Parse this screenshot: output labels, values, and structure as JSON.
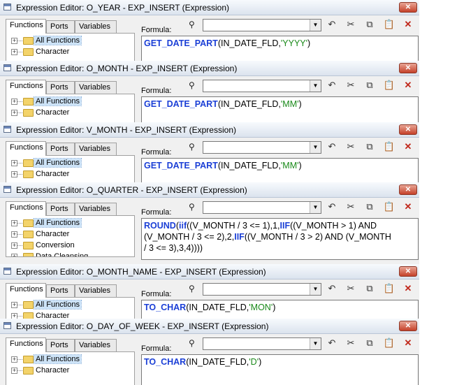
{
  "windows": [
    {
      "title": "Expression Editor: O_YEAR - EXP_INSERT (Expression)",
      "tabs": [
        "Functions",
        "Ports",
        "Variables"
      ],
      "tree_items": [
        "All Functions",
        "Character"
      ],
      "formula_label": "Formula:",
      "formula_lines": [
        [
          {
            "t": "GET_DATE_PART",
            "c": "kw"
          },
          {
            "t": "(IN_DATE_FLD,",
            "c": ""
          },
          {
            "t": "'YYYY'",
            "c": "str"
          },
          {
            "t": ")",
            "c": ""
          }
        ]
      ]
    },
    {
      "title": "Expression Editor: O_MONTH - EXP_INSERT (Expression)",
      "tabs": [
        "Functions",
        "Ports",
        "Variables"
      ],
      "tree_items": [
        "All Functions",
        "Character"
      ],
      "formula_label": "Formula:",
      "formula_lines": [
        [
          {
            "t": "GET_DATE_PART",
            "c": "kw"
          },
          {
            "t": "(IN_DATE_FLD,",
            "c": ""
          },
          {
            "t": "'MM'",
            "c": "str"
          },
          {
            "t": ")",
            "c": ""
          }
        ]
      ]
    },
    {
      "title": "Expression Editor: V_MONTH - EXP_INSERT (Expression)",
      "tabs": [
        "Functions",
        "Ports",
        "Variables"
      ],
      "tree_items": [
        "All Functions",
        "Character"
      ],
      "formula_label": "Formula:",
      "formula_lines": [
        [
          {
            "t": "GET_DATE_PART",
            "c": "kw"
          },
          {
            "t": "(IN_DATE_FLD,",
            "c": ""
          },
          {
            "t": "'MM'",
            "c": "str"
          },
          {
            "t": ")",
            "c": ""
          }
        ]
      ]
    },
    {
      "title": "Expression Editor: O_QUARTER - EXP_INSERT (Expression)",
      "tabs": [
        "Functions",
        "Ports",
        "Variables"
      ],
      "tree_items": [
        "All Functions",
        "Character",
        "Conversion",
        "Data Cleansing"
      ],
      "formula_label": "Formula:",
      "formula_lines": [
        [
          {
            "t": "ROUND",
            "c": "kw"
          },
          {
            "t": "(",
            "c": ""
          },
          {
            "t": "iif",
            "c": "kw"
          },
          {
            "t": "((V_MONTH / 3 <= 1),1,",
            "c": ""
          },
          {
            "t": "IIF",
            "c": "kw"
          },
          {
            "t": "((V_MONTH > 1) AND",
            "c": ""
          }
        ],
        [
          {
            "t": "(V_MONTH / 3 <= 2),2,",
            "c": ""
          },
          {
            "t": "IIF",
            "c": "kw"
          },
          {
            "t": "((V_MONTH / 3 > 2) AND (V_MONTH",
            "c": ""
          }
        ],
        [
          {
            "t": "/ 3 <= 3),3,4))))",
            "c": ""
          }
        ]
      ]
    },
    {
      "title": "Expression Editor: O_MONTH_NAME - EXP_INSERT (Expression)",
      "tabs": [
        "Functions",
        "Ports",
        "Variables"
      ],
      "tree_items": [
        "All Functions",
        "Character"
      ],
      "formula_label": "Formula:",
      "formula_lines": [
        [
          {
            "t": "TO_CHAR",
            "c": "kw"
          },
          {
            "t": "(IN_DATE_FLD,",
            "c": ""
          },
          {
            "t": "'MON'",
            "c": "str"
          },
          {
            "t": ")",
            "c": ""
          }
        ]
      ]
    },
    {
      "title": "Expression Editor: O_DAY_OF_WEEK - EXP_INSERT (Expression)",
      "tabs": [
        "Functions",
        "Ports",
        "Variables"
      ],
      "tree_items": [
        "All Functions",
        "Character"
      ],
      "formula_label": "Formula:",
      "formula_lines": [
        [
          {
            "t": "TO_CHAR",
            "c": "kw"
          },
          {
            "t": "(IN_DATE_FLD,",
            "c": ""
          },
          {
            "t": "'D'",
            "c": "str"
          },
          {
            "t": ")",
            "c": ""
          }
        ]
      ]
    }
  ],
  "toolbar_icons": [
    "binoculars-icon",
    "undo-icon",
    "cut-icon",
    "copy-icon",
    "paste-icon",
    "delete-icon"
  ],
  "close_glyph": "✕",
  "colors": {
    "keyword": "#1b3fd6",
    "string": "#1a8a1a",
    "titlebar": "#dbe3ee",
    "close": "#c5412a"
  }
}
